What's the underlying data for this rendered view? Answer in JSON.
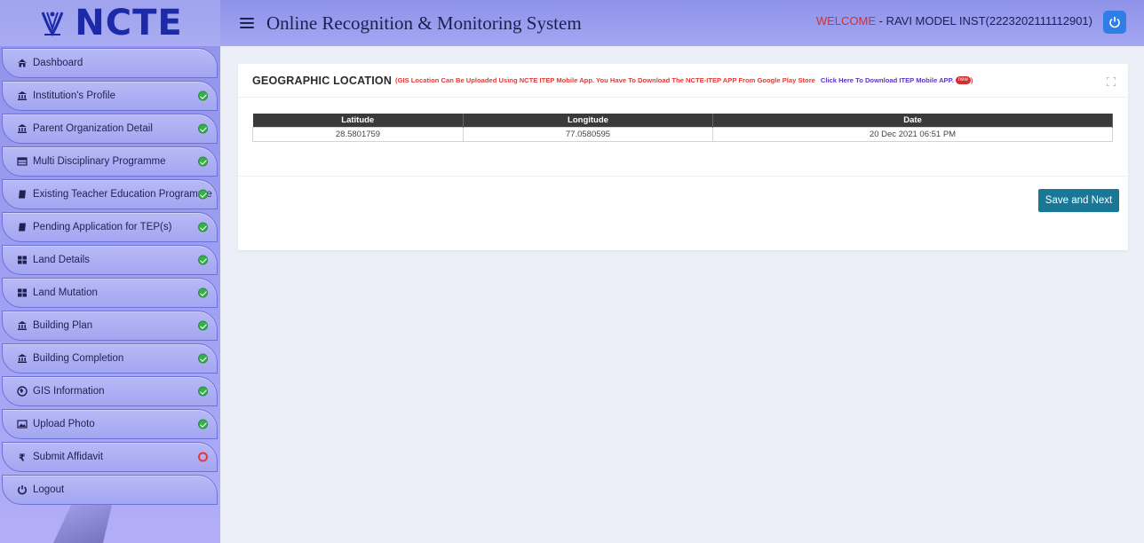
{
  "brand": {
    "name": "NCTE"
  },
  "header": {
    "title": "Online Recognition & Monitoring System",
    "welcome_label": "WELCOME",
    "welcome_user": " - RAVI MODEL INST(2223202111112901)"
  },
  "sidebar": {
    "items": [
      {
        "label": "Dashboard",
        "icon": "home-icon",
        "status": "none"
      },
      {
        "label": "Institution's Profile",
        "icon": "bank-icon",
        "status": "done"
      },
      {
        "label": "Parent Organization Detail",
        "icon": "bank-icon",
        "status": "done"
      },
      {
        "label": "Multi Disciplinary Programme",
        "icon": "table-icon",
        "status": "done"
      },
      {
        "label": "Existing Teacher Education Programme",
        "icon": "book-icon",
        "status": "done"
      },
      {
        "label": "Pending Application for TEP(s)",
        "icon": "book-icon",
        "status": "done"
      },
      {
        "label": "Land Details",
        "icon": "grid-icon",
        "status": "done"
      },
      {
        "label": "Land Mutation",
        "icon": "grid-icon",
        "status": "done"
      },
      {
        "label": "Building Plan",
        "icon": "bank-icon",
        "status": "done"
      },
      {
        "label": "Building Completion",
        "icon": "bank-icon",
        "status": "done"
      },
      {
        "label": "GIS Information",
        "icon": "globe-icon",
        "status": "done"
      },
      {
        "label": "Upload Photo",
        "icon": "image-icon",
        "status": "done"
      },
      {
        "label": "Submit Affidavit",
        "icon": "rupee-icon",
        "status": "pending"
      },
      {
        "label": "Logout",
        "icon": "power-icon",
        "status": "none"
      }
    ]
  },
  "card": {
    "title": "GEOGRAPHIC LOCATION",
    "note": "(GIS Location Can Be Uploaded Using NCTE ITEP Mobile App. You Have To Download The NCTE-ITEP APP From Google Play Store",
    "link": "Click Here To Download ITEP Mobile APP.",
    "badge": "new",
    "close_paren": ")",
    "table": {
      "headers": [
        "Latitude",
        "Longitude",
        "Date"
      ],
      "rows": [
        [
          "28.5801759",
          "77.0580595",
          "20 Dec 2021 06:51 PM"
        ]
      ]
    },
    "save_label": "Save and Next"
  },
  "colors": {
    "accent": "#1a7897",
    "sidebar": "#9a9cf0",
    "welcome": "#d32f2f",
    "done": "#36b04a",
    "pending": "#e53935"
  }
}
